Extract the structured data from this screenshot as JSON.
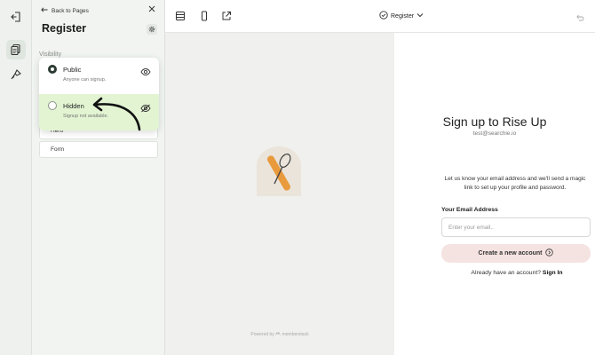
{
  "rail": {
    "icons": [
      "exit-icon",
      "pages-icon",
      "brush-icon"
    ]
  },
  "panel": {
    "back_label": "Back to Pages",
    "title": "Register",
    "visibility_label": "Visibility",
    "sections": [
      "Hero",
      "Form"
    ],
    "options": [
      {
        "label": "Public",
        "sub": "Anyone can signup.",
        "selected": true,
        "icon": "eye-icon"
      },
      {
        "label": "Hidden",
        "sub": "Signup not available.",
        "selected": false,
        "icon": "eye-off-icon"
      }
    ]
  },
  "toolbar": {
    "page_name": "Register"
  },
  "preview": {
    "powered_by": "Powered by",
    "brand": "memberstack",
    "heading": "Sign up to Rise Up",
    "email": "test@searchie.io",
    "description": "Let us know your email address and we'll send a magic link to set up your profile and password.",
    "field_label": "Your Email Address",
    "field_placeholder": "Enter your email..",
    "cta_label": "Create a new account",
    "already_text": "Already have an account?",
    "sign_in": "Sign In"
  },
  "colors": {
    "accent_green": "#e2f4d2",
    "cta_bg": "#f5e3e1",
    "dark_radio": "#2b3a33"
  }
}
